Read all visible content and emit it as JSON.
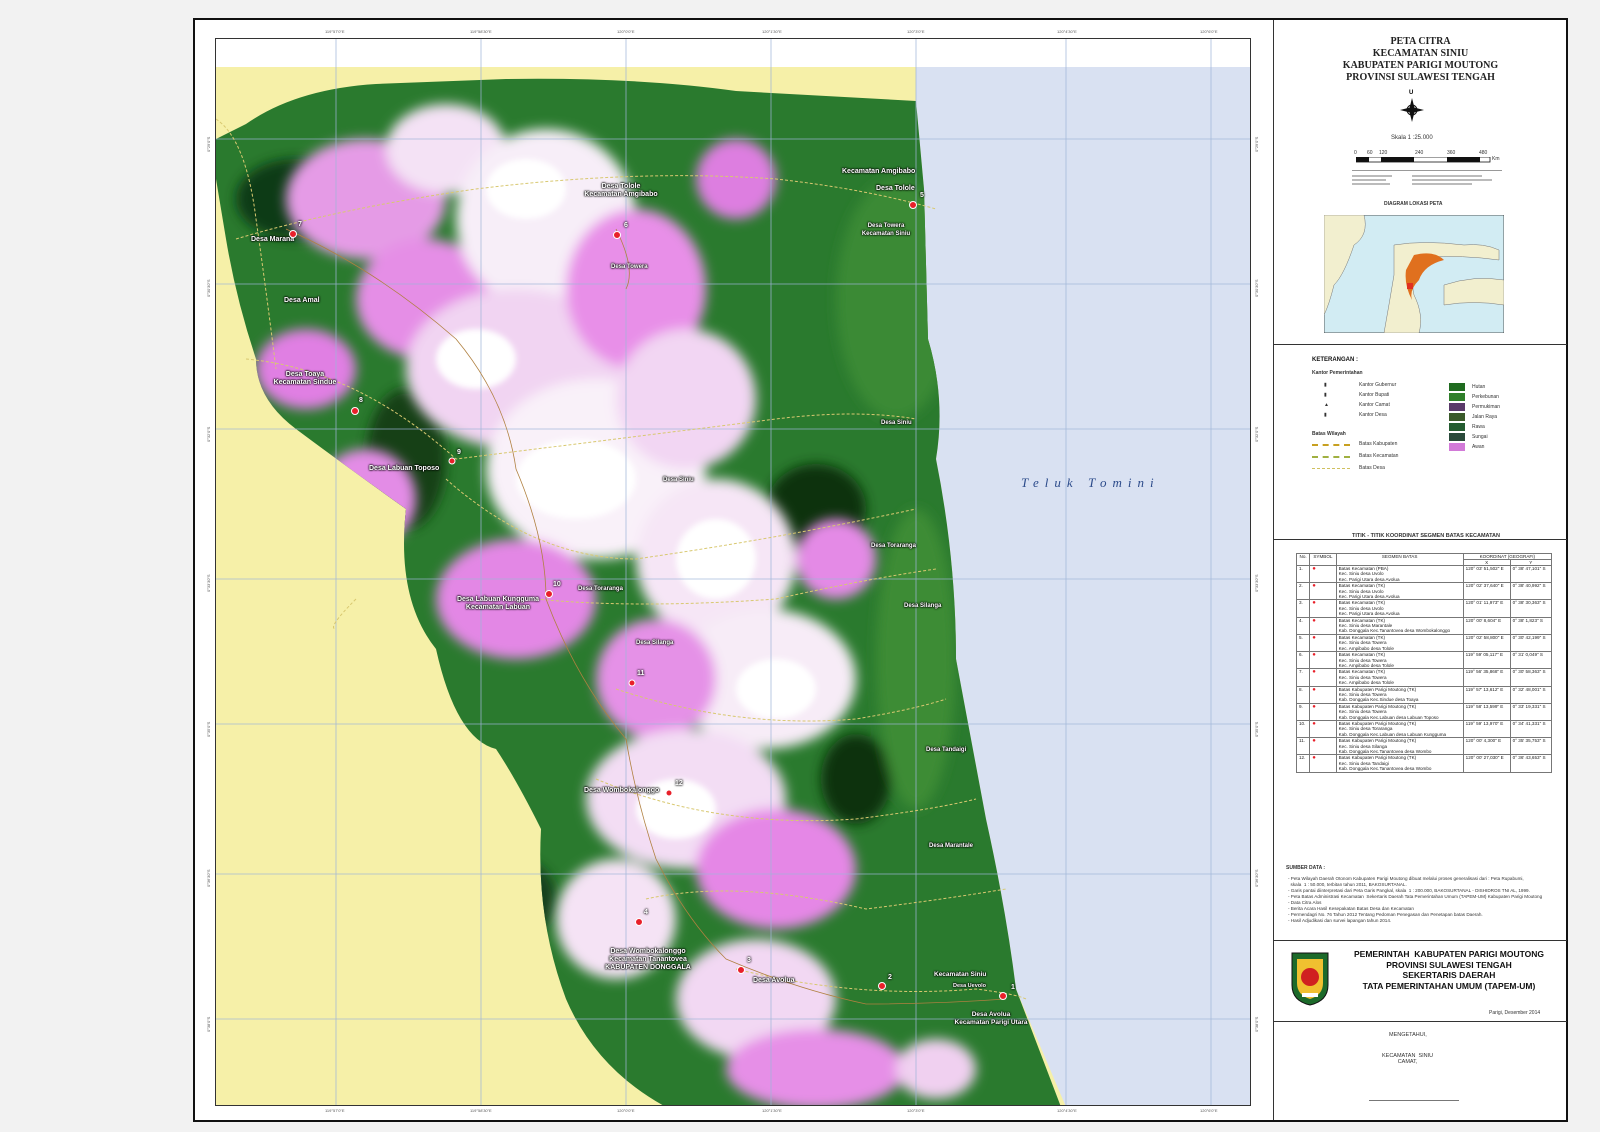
{
  "map": {
    "sea_label": "Teluk   Tomini",
    "ticks_top": [
      "119°57'0\"E",
      "119°58'30\"E",
      "120°0'0\"E",
      "120°1'30\"E",
      "120°3'0\"E",
      "120°4'30\"E",
      "120°6'0\"E"
    ],
    "ticks_bottom": [
      "119°57'0\"E",
      "119°58'30\"E",
      "120°0'0\"E",
      "120°1'30\"E",
      "120°3'0\"E",
      "120°4'30\"E",
      "120°6'0\"E"
    ],
    "ticks_left": [
      "0°29'0\"S",
      "0°30'30\"S",
      "0°32'0\"S",
      "0°33'30\"S",
      "0°35'0\"S",
      "0°36'30\"S",
      "0°38'0\"S"
    ],
    "ticks_right": [
      "0°29'0\"S",
      "0°30'30\"S",
      "0°32'0\"S",
      "0°33'30\"S",
      "0°35'0\"S",
      "0°36'30\"S",
      "0°38'0\"S"
    ],
    "labels": [
      {
        "text": "Kecamatan Amgibabo"
      },
      {
        "text": "Desa Tolole"
      },
      {
        "text": "Desa Tolole\nKecamatan Amgibabo"
      },
      {
        "text": "Desa Towera\nKecamatan Siniu"
      },
      {
        "text": "Desa Marana"
      },
      {
        "text": "Desa Towera"
      },
      {
        "text": "Desa Amal"
      },
      {
        "text": "Desa Toaya\nKecamatan Sindue"
      },
      {
        "text": "Desa Siniu"
      },
      {
        "text": "Desa Labuan Toposo"
      },
      {
        "text": "Desa Siniu"
      },
      {
        "text": "Desa Toraranga"
      },
      {
        "text": "Desa Toraranga"
      },
      {
        "text": "Desa Labuan Kungguma\nKecamatan Labuan"
      },
      {
        "text": "Desa Silanga"
      },
      {
        "text": "Desa Silanga"
      },
      {
        "text": "Desa Tandaigi"
      },
      {
        "text": "Desa Wombokalonggo"
      },
      {
        "text": "Desa Marantale"
      },
      {
        "text": "Desa Wombokalonggo\nKecamatan Tanantovea\nKABUPATEN DONGGALA"
      },
      {
        "text": "Desa Avolua"
      },
      {
        "text": "Kecamatan Siniu"
      },
      {
        "text": "Desa Uevolo"
      },
      {
        "text": "Desa Avolua\nKecamatan Parigi Utara"
      }
    ],
    "points": [
      {
        "n": "1"
      },
      {
        "n": "2"
      },
      {
        "n": "3"
      },
      {
        "n": "4"
      },
      {
        "n": "5"
      },
      {
        "n": "6"
      },
      {
        "n": "7"
      },
      {
        "n": "8"
      },
      {
        "n": "9"
      },
      {
        "n": "10"
      },
      {
        "n": "11"
      },
      {
        "n": "12"
      }
    ]
  },
  "panel": {
    "title": "PETA CITRA\nKECAMATAN SINIU\nKABUPATEN PARIGI MOUTONG\nPROVINSI SULAWESI TENGAH",
    "north": "U",
    "scale_text": "Skala   1 :25.000",
    "scale_ticks": [
      "0",
      "60",
      "120",
      "240",
      "360",
      "480"
    ],
    "scale_unit": "Km",
    "locator_title": "DIAGRAM LOKASI PETA",
    "legend_title": "KETERANGAN :",
    "legend_gov": "Kantor Pemerintahan",
    "legend_points": [
      "Kantor Gubernur",
      "Kantor Bupati",
      "Kantor Camat",
      "Kantor Desa"
    ],
    "legend_batas": "Batas Wilayah",
    "legend_lines": [
      "Batas Kabupaten",
      "Batas Kecamatan",
      "Batas Desa"
    ],
    "legend_areas": [
      {
        "label": "Hutan",
        "color": "#1f6b1f"
      },
      {
        "label": "Perkebunan",
        "color": "#2f7f2a"
      },
      {
        "label": "Permukiman",
        "color": "#5a3a6a"
      },
      {
        "label": "Jalan Raya",
        "color": "#3a5a2a"
      },
      {
        "label": "Rawa",
        "color": "#245c30"
      },
      {
        "label": "Sungai",
        "color": "#2a4a3a"
      },
      {
        "label": "Awan",
        "color": "#d27ad8"
      }
    ],
    "table_title": "TITIK - TITIK KOORDINAT SEGMEN BATAS KECAMATAN",
    "table_headers": {
      "no": "No.",
      "symbol": "SYMBOL",
      "segment": "SEGMEN BATAS",
      "coord": "KOORDINAT  (GEOGRAFI)",
      "x": "X",
      "y": "Y"
    },
    "table_rows": [
      {
        "no": "1.",
        "seg": "Batas Kecamatan (PBA)\nKec. Siniu desa Uvolo\nKec. Parigi Utara desa Avolua",
        "x": "120° 03' 51,502\" E",
        "y": "0° 38' 47,101\" S"
      },
      {
        "no": "2.",
        "seg": "Batas Kecamatan (TK)\nKec. Siniu desa Uvolo\nKec. Parigi Utara desa Avolua",
        "x": "120° 02' 37,640\" E",
        "y": "0° 38' 40,992\" S"
      },
      {
        "no": "3.",
        "seg": "Batas Kecamatan (TK)\nKec. Siniu desa Uvolo\nKec. Parigi Utara desa Avolua",
        "x": "120° 01' 11,973\" E",
        "y": "0° 38' 30,363\" S"
      },
      {
        "no": "4.",
        "seg": "Batas Kecamatan (TK)\nKec. Siniu desa Marantale\nKab. Donggala Kec.Tanantovea desa Wombokalonggo",
        "x": "120° 00' 8,604\" E",
        "y": "0° 38' 1,823\" S"
      },
      {
        "no": "5.",
        "seg": "Batas Kecamatan (TK)\nKec. Siniu desa Towera\nKec. Ampibabo desa Tolole",
        "x": "120° 02' 58,800\" E",
        "y": "0° 30' 42,199\" S"
      },
      {
        "no": "6.",
        "seg": "Batas Kecamatan (TK)\nKec. Siniu desa Towera\nKec. Ampibabo desa Tolole",
        "x": "119° 59' 05,117\" E",
        "y": "0° 31' 0,049\" S"
      },
      {
        "no": "7.",
        "seg": "Batas Kecamatan (TK)\nKec. Siniu desa Towera\nKec. Ampibabo desa Tolole",
        "x": "119° 56' 35,868\" E",
        "y": "0° 30' 58,363\" S"
      },
      {
        "no": "8.",
        "seg": "Batas Kabupaten Parigi Moutong  (TK)\nKec. Siniu desa Towera\nKab. Donggala Kec.Sindue desa Toaya",
        "x": "119° 57' 13,612\" E",
        "y": "0° 32' 48,001\" S"
      },
      {
        "no": "9.",
        "seg": "Batas Kabupaten Parigi Moutong  (TK)\nKec. Siniu desa Towera\nKab. Donggala Kec.Labuan desa Labuan Toposo",
        "x": "119° 58' 13,599\" E",
        "y": "0° 33' 19,331\" S"
      },
      {
        "no": "10.",
        "seg": "Batas Kabupaten Parigi Moutong  (TK)\nKec. Siniu desa Toraranga\nKab. Donggala Kec.Labuan desa Labuan Kungguma",
        "x": "119° 59' 13,970\" E",
        "y": "0° 34' 41,331\" S"
      },
      {
        "no": "11.",
        "seg": "Batas Kabupaten Parigi Moutong  (TK)\nKec. Siniu desa Silanga\nKab. Donggala Kec.Tanantovea desa Wombo",
        "x": "120° 00' 4,300\" E",
        "y": "0° 35' 35,753\" S"
      },
      {
        "no": "12.",
        "seg": "Batas Kabupaten Parigi Moutong  (TK)\nKec. Siniu desa Tandaigi\nKab. Donggala Kec.Tanantovea desa Wombo",
        "x": "120° 00' 27,030\" E",
        "y": "0° 36' 43,653\" S"
      }
    ],
    "sumber_title": "SUMBER DATA :",
    "sumber_lines": [
      "- Peta Wilayah Daerah Otonom Kabupaten Parigi Moutong dibuat melalui proses generalisasi dari : Peta Rupabumi,",
      "  skala  1 : 50.000, terbitan tahun 2011, BAKOSURTANAL.",
      "- Garis pantai diinterpretasi dari Peta Garis Pangkal, skala  1 : 200.000, BAKOSURTANAL - DISHIDROS TNI AL, 1999.",
      "- Peta Batas Administrasi Kecamatan  Sekertaris Daerah Tata Pemerintahan Umum (TAPEM-UM) Kabupaten Parigi Moutong",
      "- Data Citra Alos",
      "- Berita Acara Hasil Kesepakatan Batas Desa dan Kecamatan",
      "- Permendagri No. 76 Tahun 2012 Tentang Pedoman Penegasan dan Penetapan batas Daerah.",
      "- Hasil Adjudikasi dan survei lapangan tahun 2014."
    ],
    "gov_text": "PEMERINTAH  KABUPATEN PARIGI MOUTONG\nPROVINSI SULAWESI TENGAH\nSEKERTARIS DAERAH\nTATA PEMERINTAHAN UMUM (TAPEM-UM)",
    "date_text": "Parigi,    Desember  2014",
    "mengetahui": "MENGETAHUI,",
    "signer": "KECAMATAN  SINIU\nCAMAT,"
  }
}
